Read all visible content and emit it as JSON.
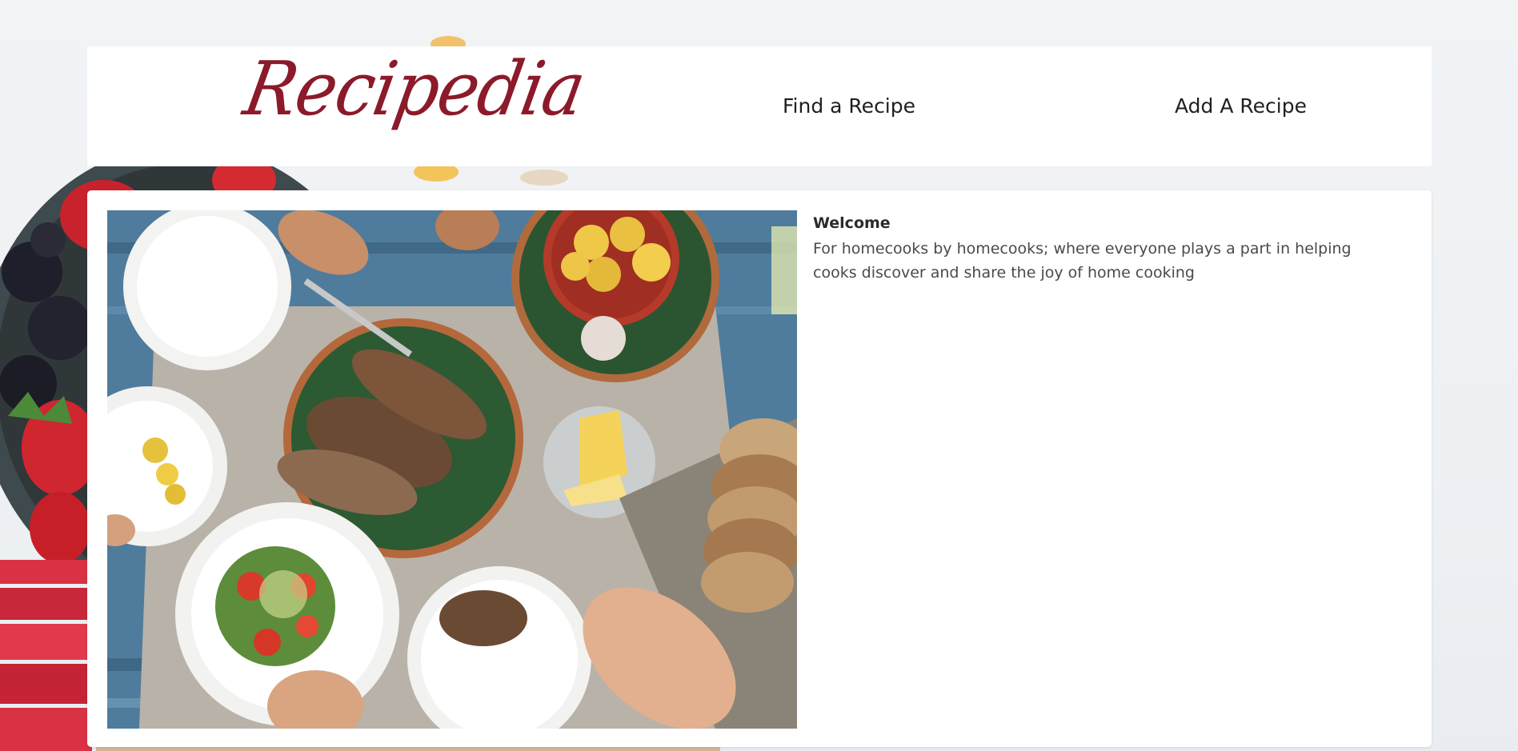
{
  "header": {
    "logo_text": "Recipedia",
    "nav": {
      "find_recipe": "Find a Recipe",
      "add_recipe": "Add A Recipe"
    }
  },
  "main": {
    "hero_image": "food-table-photo",
    "welcome_title": "Welcome",
    "welcome_text": "For homecooks by homecooks; where everyone plays a part in helping cooks discover and share the joy of home cooking"
  },
  "colors": {
    "brand": "#8b1a2a",
    "nav_text": "#1f1f1f",
    "body_text": "#4a4a4a",
    "page_background": "#eef1f4",
    "card_background": "#ffffff"
  }
}
